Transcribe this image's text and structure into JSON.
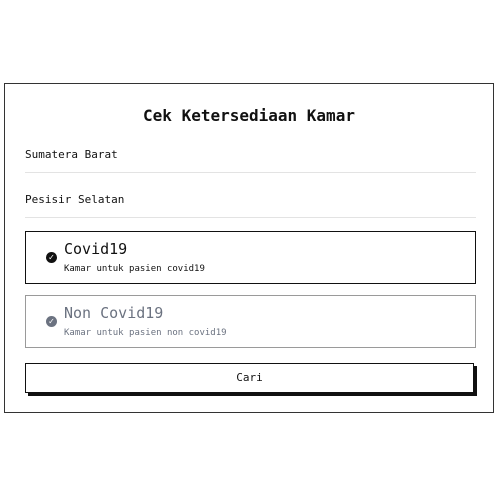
{
  "form": {
    "title": "Cek Ketersediaan Kamar",
    "province_value": "Sumatera Barat",
    "city_value": "Pesisir Selatan"
  },
  "options": [
    {
      "title": "Covid19",
      "description": "Kamar untuk pasien covid19",
      "selected": true,
      "icon": "check-circle-icon"
    },
    {
      "title": "Non Covid19",
      "description": "Kamar untuk pasien non covid19",
      "selected": false,
      "icon": "check-circle-icon"
    }
  ],
  "actions": {
    "search_label": "Cari"
  },
  "colors": {
    "primary": "#111111",
    "muted": "#6b7280",
    "border_muted": "#9a9a9a",
    "divider": "#e3e3e3"
  }
}
